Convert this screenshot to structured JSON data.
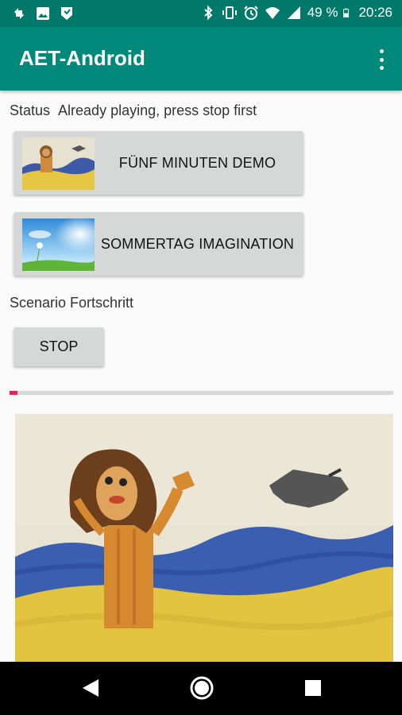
{
  "status_bar": {
    "battery_percent": "49 %",
    "time": "20:26",
    "left_icons": [
      "sync-icon",
      "image-icon",
      "signal-flag-icon"
    ],
    "right_icons": [
      "bluetooth-icon",
      "vibrate-icon",
      "alarm-icon",
      "wifi-icon",
      "cell-signal-icon",
      "battery-icon"
    ]
  },
  "app_bar": {
    "title": "AET-Android",
    "menu_icon": "overflow-menu-icon"
  },
  "status": {
    "label": "Status",
    "message": "Already playing, press stop first"
  },
  "scenarios": [
    {
      "label": "FÜNF MINUTEN DEMO",
      "thumbnail": "child-drawing-beach"
    },
    {
      "label": "SOMMERTAG IMAGINATION",
      "thumbnail": "summer-sky-dandelion"
    }
  ],
  "progress": {
    "label": "Scenario Fortschritt",
    "stop_label": "STOP",
    "value": 0.02,
    "color": "#e91e63"
  },
  "scene_image": {
    "subject": "child-drawing-beach"
  },
  "colors": {
    "app_bar": "#00897b",
    "status_bar": "#00796b",
    "button": "#d6d7d7"
  },
  "nav_bar": {
    "icons": [
      "back-icon",
      "home-icon",
      "recents-icon"
    ]
  }
}
